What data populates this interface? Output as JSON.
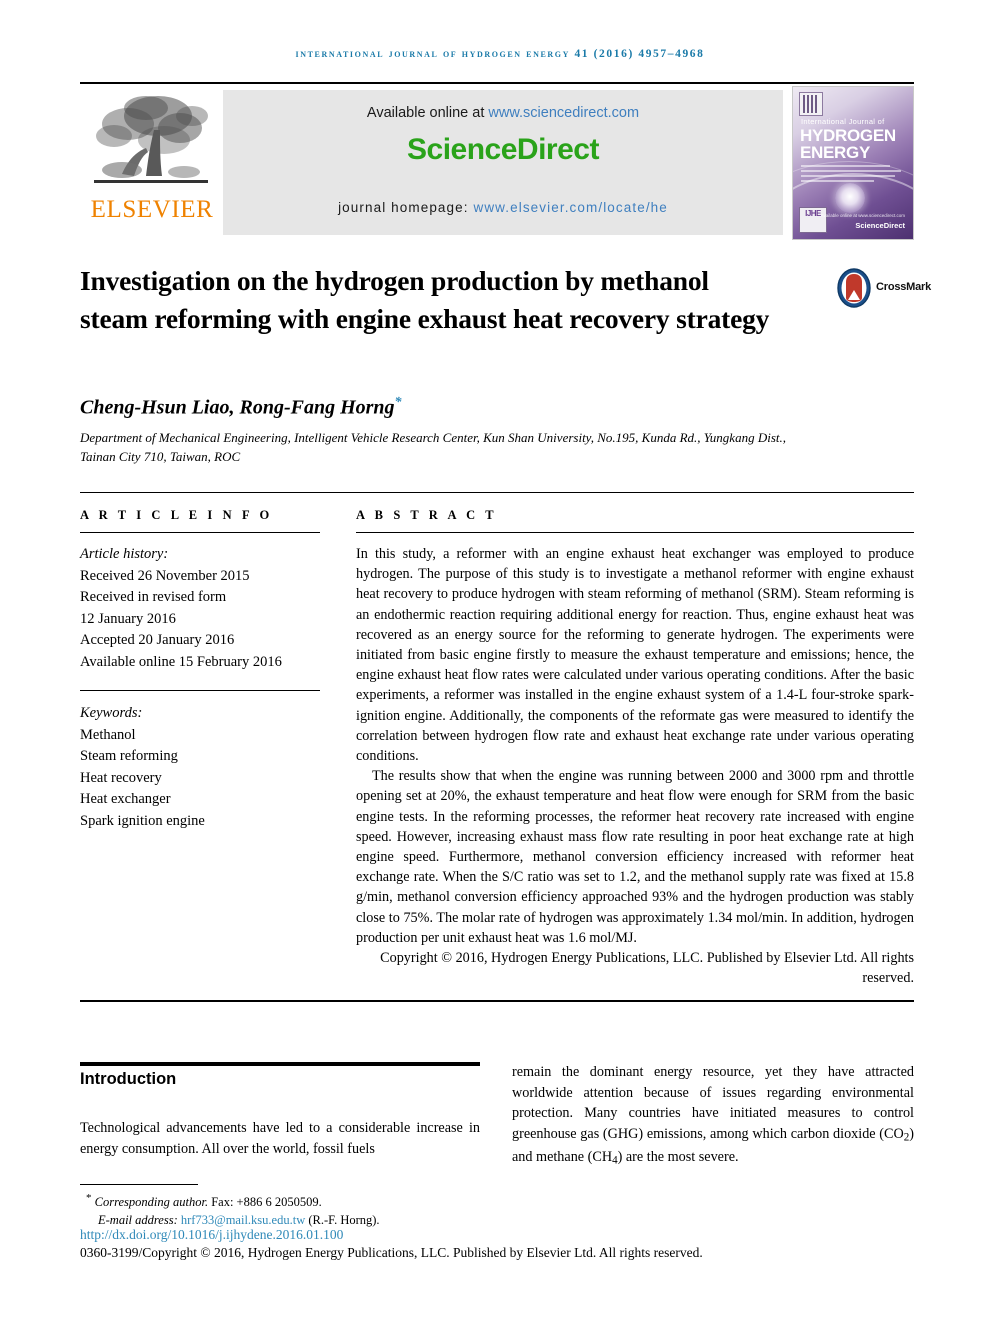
{
  "running_head": "International Journal of Hydrogen Energy 41 (2016) 4957–4968",
  "masthead": {
    "publisher": "ELSEVIER",
    "available_prefix": "Available online at ",
    "available_url": "www.sciencedirect.com",
    "sciencedirect_logo": "ScienceDirect",
    "homepage_prefix": "journal homepage: ",
    "homepage_url": "www.elsevier.com/locate/he",
    "cover": {
      "line_small": "International Journal of",
      "line_big_1": "HYDROGEN",
      "line_big_2": "ENERGY",
      "badge": "IJHE",
      "sciencedirect": "ScienceDirect",
      "tagline": "Available online at www.sciencedirect.com"
    }
  },
  "article": {
    "title": "Investigation on the hydrogen production by methanol steam reforming with engine exhaust heat recovery strategy",
    "crossmark_label": "CrossMark",
    "authors": "Cheng-Hsun Liao, Rong-Fang Horng",
    "corresponding_marker": "*",
    "affiliation": "Department of Mechanical Engineering, Intelligent Vehicle Research Center, Kun Shan University, No.195, Kunda Rd., Yungkang Dist., Tainan City 710, Taiwan, ROC"
  },
  "info": {
    "heading": "A R T I C L E  I N F O",
    "history_label": "Article history:",
    "history": [
      "Received 26 November 2015",
      "Received in revised form",
      "12 January 2016",
      "Accepted 20 January 2016",
      "Available online 15 February 2016"
    ],
    "keywords_label": "Keywords:",
    "keywords": [
      "Methanol",
      "Steam reforming",
      "Heat recovery",
      "Heat exchanger",
      "Spark ignition engine"
    ]
  },
  "abstract": {
    "heading": "A B S T R A C T",
    "paragraph_1": "In this study, a reformer with an engine exhaust heat exchanger was employed to produce hydrogen. The purpose of this study is to investigate a methanol reformer with engine exhaust heat recovery to produce hydrogen with steam reforming of methanol (SRM). Steam reforming is an endothermic reaction requiring additional energy for reaction. Thus, engine exhaust heat was recovered as an energy source for the reforming to generate hydrogen. The experiments were initiated from basic engine firstly to measure the exhaust temperature and emissions; hence, the engine exhaust heat flow rates were calculated under various operating conditions. After the basic experiments, a reformer was installed in the engine exhaust system of a 1.4-L four-stroke spark-ignition engine. Additionally, the components of the reformate gas were measured to identify the correlation between hydrogen flow rate and exhaust heat exchange rate under various operating conditions.",
    "paragraph_2": "The results show that when the engine was running between 2000 and 3000 rpm and throttle opening set at 20%, the exhaust temperature and heat flow were enough for SRM from the basic engine tests. In the reforming processes, the reformer heat recovery rate increased with engine speed. However, increasing exhaust mass flow rate resulting in poor heat exchange rate at high engine speed. Furthermore, methanol conversion efficiency increased with reformer heat exchange rate. When the S/C ratio was set to 1.2, and the methanol supply rate was fixed at 15.8 g/min, methanol conversion efficiency approached 93% and the hydrogen production was stably close to 75%. The molar rate of hydrogen was approximately 1.34 mol/min. In addition, hydrogen production per unit exhaust heat was 1.6 mol/MJ.",
    "copyright": "Copyright © 2016, Hydrogen Energy Publications, LLC. Published by Elsevier Ltd. All rights reserved."
  },
  "introduction": {
    "heading": "Introduction",
    "column_left": "Technological advancements have led to a considerable increase in energy consumption. All over the world, fossil fuels",
    "column_right_pre": "remain the dominant energy resource, yet they have attracted worldwide attention because of issues regarding environmental protection. Many countries have initiated measures to control greenhouse gas (GHG) emissions, among which carbon dioxide (CO",
    "column_right_mid": ") and methane (CH",
    "column_right_post": ") are the most severe.",
    "sub_co2": "2",
    "sub_ch4": "4"
  },
  "footer": {
    "corresponding_star": "*",
    "corresponding_label": "Corresponding author.",
    "fax": "Fax: +886 6 2050509.",
    "email_label": "E-mail address:",
    "email": "hrf733@mail.ksu.edu.tw",
    "email_owner": "(R.-F. Horng).",
    "doi": "http://dx.doi.org/10.1016/j.ijhydene.2016.01.100",
    "issn_line": "0360-3199/Copyright © 2016, Hydrogen Energy Publications, LLC. Published by Elsevier Ltd. All rights reserved."
  },
  "colors": {
    "link_blue": "#2f89b8",
    "sciencedirect_green": "#2aa31a",
    "elsevier_orange": "#ef8200",
    "banner_gray": "#e6e6e6"
  }
}
